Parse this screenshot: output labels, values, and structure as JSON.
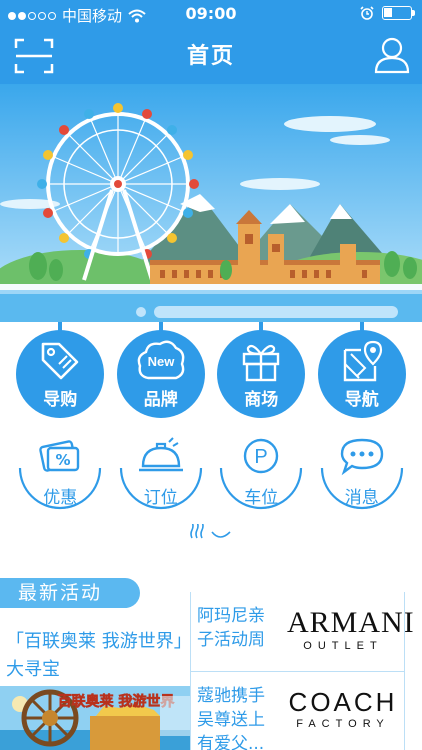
{
  "status": {
    "carrier": "中国移动",
    "time": "09:00"
  },
  "nav": {
    "title": "首页"
  },
  "main_menu": [
    {
      "label": "导购",
      "icon": "tag-icon"
    },
    {
      "label": "品牌",
      "icon": "new-badge-icon",
      "badge": "New"
    },
    {
      "label": "商场",
      "icon": "gift-icon"
    },
    {
      "label": "导航",
      "icon": "map-pin-icon"
    }
  ],
  "sub_menu": [
    {
      "label": "优惠",
      "icon": "coupon-icon",
      "symbol": "%"
    },
    {
      "label": "订位",
      "icon": "service-bell-icon"
    },
    {
      "label": "车位",
      "icon": "parking-icon",
      "symbol": "P"
    },
    {
      "label": "消息",
      "icon": "chat-bubble-icon"
    }
  ],
  "activities": {
    "section_title": "最新活动",
    "featured": {
      "title": "「百联奥莱 我游世界」大寻宝",
      "image_text": "百联奥莱 我游世界"
    },
    "items": [
      {
        "title": "阿玛尼亲子活动周",
        "brand": "ARMANI",
        "brand_sub": "OUTLET"
      },
      {
        "title": "蔻驰携手吴尊送上有爱父...",
        "brand": "COACH",
        "brand_sub": "FACTORY"
      }
    ]
  },
  "colors": {
    "primary": "#2f9be8",
    "light": "#5bb8f0",
    "divider": "#bcdff6"
  }
}
